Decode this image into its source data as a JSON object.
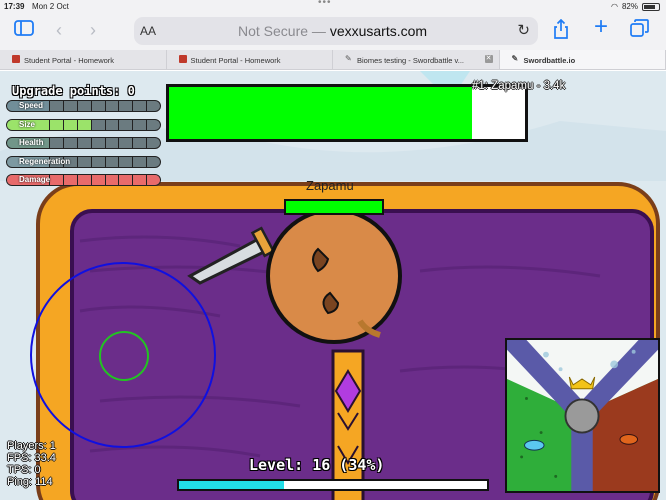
{
  "status": {
    "time": "17:39",
    "date": "Mon 2 Oct",
    "battery": "82%",
    "battery_level": 0.82
  },
  "toolbar": {
    "text_size_label": "AA",
    "security_label": "Not Secure —",
    "host": "vexxusarts.com",
    "icons": [
      "sidebar-icon",
      "back-icon",
      "forward-icon",
      "reload-icon",
      "share-icon",
      "new-tab-icon",
      "tab-overview-icon"
    ]
  },
  "tabs": [
    {
      "label": "Student Portal - Homework",
      "icon": "portal-favicon",
      "active": false
    },
    {
      "label": "Student Portal - Homework",
      "icon": "portal-favicon",
      "active": false
    },
    {
      "label": "Biomes testing - Swordbattle v...",
      "icon": "sword-favicon",
      "active": false
    },
    {
      "label": "Swordbattle.io",
      "icon": "sword-favicon",
      "active": true
    }
  ],
  "game": {
    "upgrade_points_label": "Upgrade points: 0",
    "upgrades": [
      {
        "name": "Speed",
        "level": 0,
        "color": "#7fb3c8"
      },
      {
        "name": "Size",
        "level": 3,
        "color": "#9be36a"
      },
      {
        "name": "Health",
        "level": 0,
        "color": "#7fc89a"
      },
      {
        "name": "Regeneration",
        "level": 0,
        "color": "#a0d0e0"
      },
      {
        "name": "Damage",
        "level": 8,
        "color": "#e86b6b"
      }
    ],
    "upgrade_max": 8,
    "leaderboard_entry": "#1: Zapamu - 3.4k",
    "leader_bar_fraction": 0.85,
    "player_name": "Zapamu",
    "player_health_fraction": 1.0,
    "hud": [
      "Players: 1",
      "FPS: 33.4",
      "TPS: 0",
      "Ping: 114"
    ],
    "level_label": "Level: 16 (34%)",
    "level_progress": 0.34,
    "colors": {
      "arena_orange": "#f5a623",
      "arena_purple": "#6b2d8a",
      "health_green": "#00ff00",
      "xp_cyan": "#22dfe8",
      "joystick_blue": "#1010e0"
    }
  }
}
